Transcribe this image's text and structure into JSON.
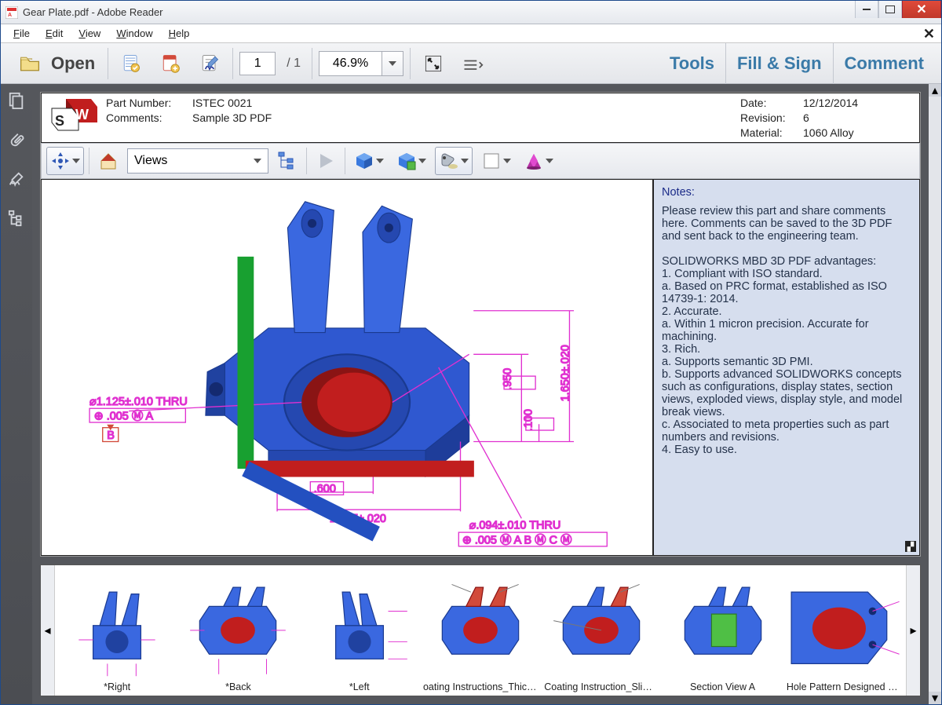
{
  "window": {
    "title": "Gear Plate.pdf - Adobe Reader"
  },
  "menu": {
    "file": "File",
    "edit": "Edit",
    "view": "View",
    "window": "Window",
    "help": "Help"
  },
  "toolbar": {
    "open": "Open",
    "page_current": "1",
    "page_total": "/  1",
    "zoom": "46.9%",
    "tools": "Tools",
    "fillSign": "Fill & Sign",
    "comment": "Comment"
  },
  "leftrail": {
    "thumbnails": "page-thumbnails",
    "attachments": "attachments",
    "sign": "signatures",
    "model": "model-tree"
  },
  "meta": {
    "partNumberLabel": "Part Number:",
    "partNumber": "ISTEC 0021",
    "commentsLabel": "Comments:",
    "comments": "Sample 3D PDF",
    "dateLabel": "Date:",
    "date": "12/12/2014",
    "revisionLabel": "Revision:",
    "revision": "6",
    "materialLabel": "Material:",
    "material": "1060 Alloy"
  },
  "toolbar3d": {
    "viewsLabel": "Views"
  },
  "notes": {
    "header": "Notes:",
    "p1": "Please review this part and share comments here. Comments can be saved to the 3D PDF and sent back to the engineering team.",
    "advHeader": "SOLIDWORKS MBD 3D PDF advantages:",
    "l1": "1. Compliant with ISO standard.",
    "l1a": "a. Based on PRC format, established as ISO 14739-1: 2014.",
    "l2": "2. Accurate.",
    "l2a": "a. Within 1 micron precision. Accurate for machining.",
    "l3": "3. Rich.",
    "l3a": "a. Supports semantic 3D PMI.",
    "l3b": "b. Supports advanced SOLIDWORKS concepts such as configurations, display states, section views, exploded views, display style, and model break views.",
    "l3c": "c. Associated to meta properties such as part numbers and revisions.",
    "l4": "4. Easy to use."
  },
  "dimensions": {
    "d1": "⌀1.125±.010 THRU",
    "d1t": "⊕ .005 Ⓜ A",
    "d1b": "B",
    "d2": ".600",
    "d3": "1.597±.020",
    "d4": "⌀.094±.010 THRU",
    "d4t": "⊕ .005 Ⓜ A B Ⓜ C Ⓜ",
    "d5": ".950",
    "d6": ".100",
    "d7": "1.650±.020"
  },
  "thumbs": {
    "t1": "*Right",
    "t2": "*Back",
    "t3": "*Left",
    "t4": "oating Instructions_Thick Ar",
    "t5": "Coating Instruction_Slim_Arm",
    "t6": "Section View A",
    "t7": "Hole Pattern Designed View"
  }
}
